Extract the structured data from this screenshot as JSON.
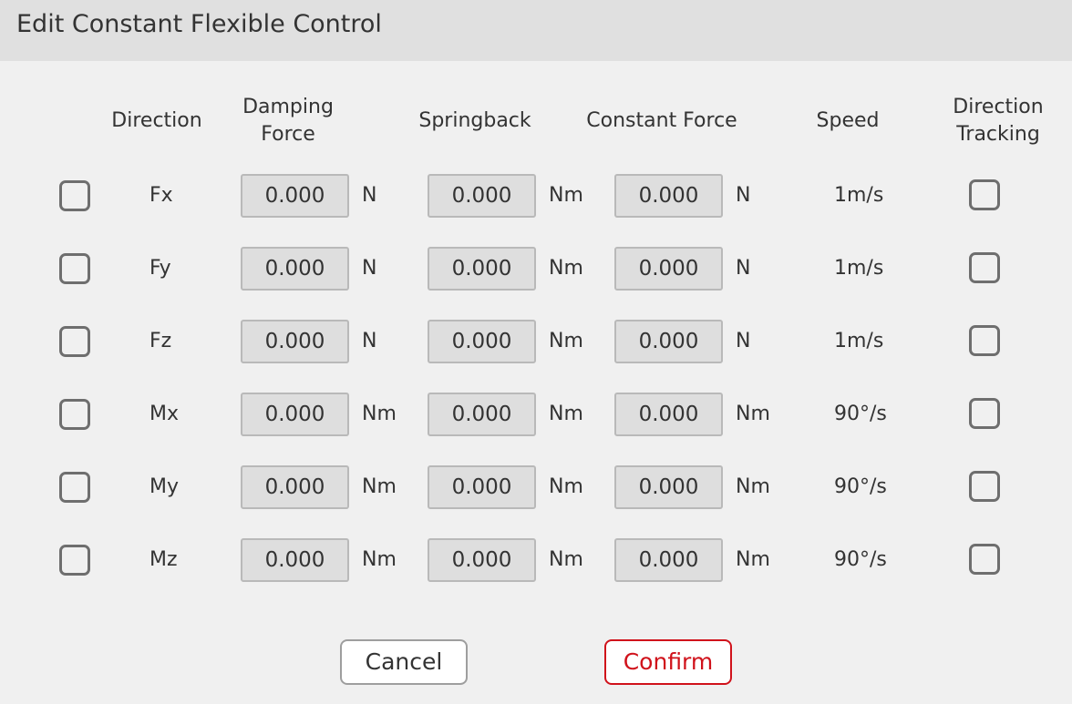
{
  "dialog": {
    "title": "Edit Constant Flexible Control"
  },
  "headers": {
    "direction": "Direction",
    "damping_force": "Damping\nForce",
    "springback": "Springback",
    "constant_force": "Constant Force",
    "speed": "Speed",
    "direction_tracking": "Direction\nTracking"
  },
  "rows": [
    {
      "direction": "Fx",
      "enabled": false,
      "damping": "0.000",
      "damping_unit": "N",
      "springback": "0.000",
      "springback_unit": "Nm",
      "constant_force": "0.000",
      "constant_force_unit": "N",
      "speed": "1m/s",
      "tracking": false
    },
    {
      "direction": "Fy",
      "enabled": false,
      "damping": "0.000",
      "damping_unit": "N",
      "springback": "0.000",
      "springback_unit": "Nm",
      "constant_force": "0.000",
      "constant_force_unit": "N",
      "speed": "1m/s",
      "tracking": false
    },
    {
      "direction": "Fz",
      "enabled": false,
      "damping": "0.000",
      "damping_unit": "N",
      "springback": "0.000",
      "springback_unit": "Nm",
      "constant_force": "0.000",
      "constant_force_unit": "N",
      "speed": "1m/s",
      "tracking": false
    },
    {
      "direction": "Mx",
      "enabled": false,
      "damping": "0.000",
      "damping_unit": "Nm",
      "springback": "0.000",
      "springback_unit": "Nm",
      "constant_force": "0.000",
      "constant_force_unit": "Nm",
      "speed": "90°/s",
      "tracking": false
    },
    {
      "direction": "My",
      "enabled": false,
      "damping": "0.000",
      "damping_unit": "Nm",
      "springback": "0.000",
      "springback_unit": "Nm",
      "constant_force": "0.000",
      "constant_force_unit": "Nm",
      "speed": "90°/s",
      "tracking": false
    },
    {
      "direction": "Mz",
      "enabled": false,
      "damping": "0.000",
      "damping_unit": "Nm",
      "springback": "0.000",
      "springback_unit": "Nm",
      "constant_force": "0.000",
      "constant_force_unit": "Nm",
      "speed": "90°/s",
      "tracking": false
    }
  ],
  "buttons": {
    "cancel": "Cancel",
    "confirm": "Confirm"
  },
  "colors": {
    "accent": "#d0121b",
    "title_bar": "#e0e0e0",
    "background": "#f0f0f0",
    "input_bg": "#dedede"
  }
}
